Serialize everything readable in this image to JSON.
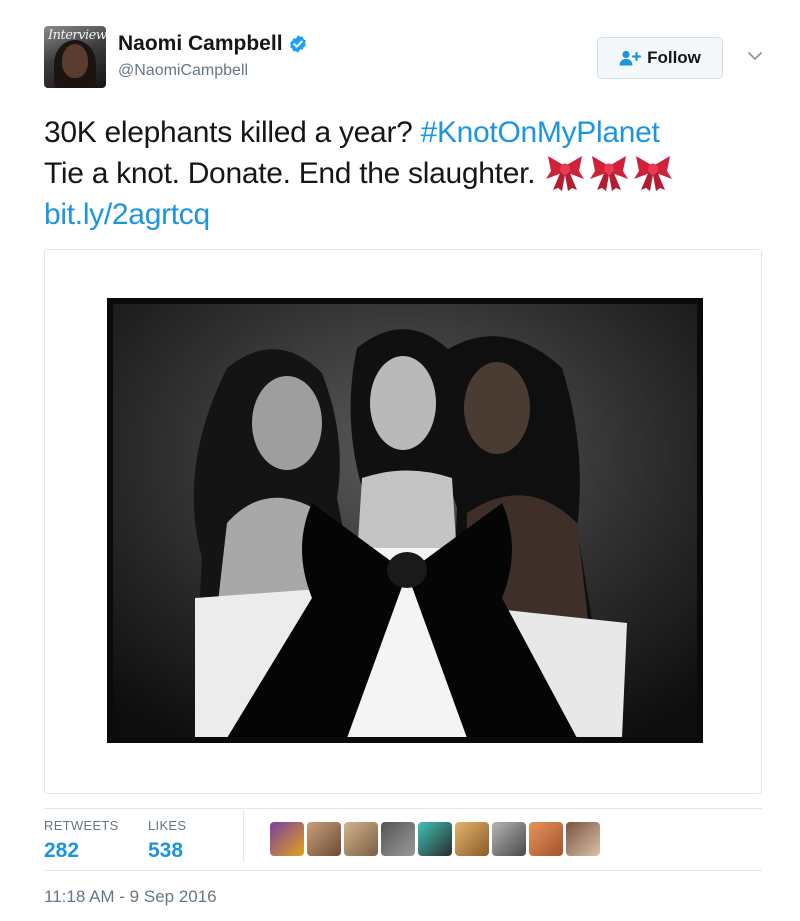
{
  "author": {
    "display_name": "Naomi Campbell",
    "handle": "@NaomiCampbell",
    "avatar_text": "Interview",
    "verified": true
  },
  "follow_button": {
    "label": "Follow",
    "icon": "follow-person-plus-icon"
  },
  "tweet": {
    "text_part1": "30K elephants killed a year? ",
    "hashtag": "#KnotOnMyPlanet",
    "text_part2": "Tie a knot. Donate. End the slaughter.",
    "emojis": [
      "ribbon-bow-emoji",
      "ribbon-bow-emoji",
      "ribbon-bow-emoji"
    ],
    "link": "bit.ly/2agrtcq"
  },
  "stats": {
    "retweets_label": "RETWEETS",
    "retweets_value": "282",
    "likes_label": "LIKES",
    "likes_value": "538"
  },
  "timestamp": "11:18 AM - 9 Sep 2016",
  "colors": {
    "accent": "#1b95e0",
    "text": "#14171a",
    "muted": "#657786",
    "border": "#e1e8ed",
    "emoji_red": "#d0213b"
  }
}
